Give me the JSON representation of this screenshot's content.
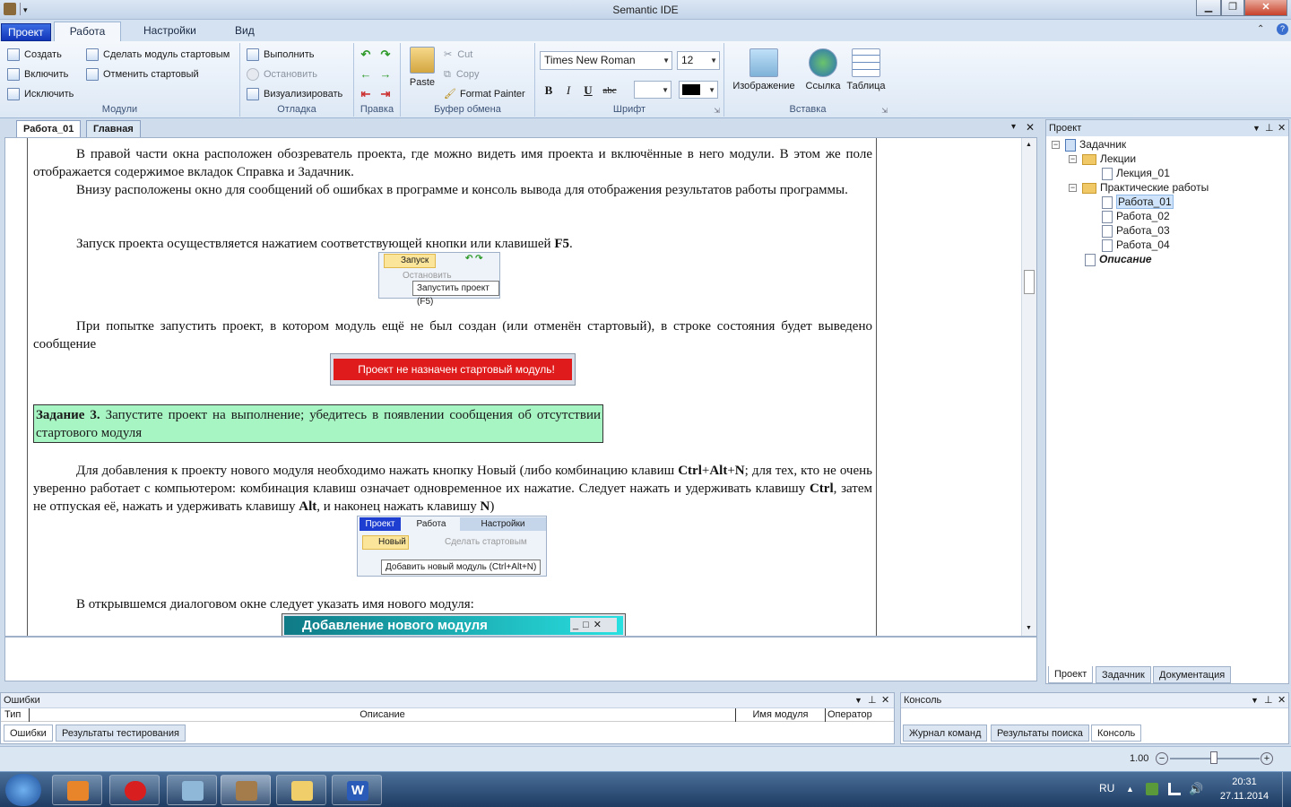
{
  "window": {
    "title": "Semantic IDE"
  },
  "ribbon_tabs": [
    "Проект",
    "Работа",
    "Настройки",
    "Вид"
  ],
  "groups": {
    "modules": {
      "label": "Модули",
      "create": "Создать",
      "include": "Включить",
      "exclude": "Исключить",
      "make_start": "Сделать модуль стартовым",
      "cancel_start": "Отменить стартовый"
    },
    "debug": {
      "label": "Отладка",
      "run": "Выполнить",
      "stop": "Остановить",
      "visualize": "Визуализировать"
    },
    "edit": {
      "label": "Правка"
    },
    "clipboard": {
      "label": "Буфер обмена",
      "paste": "Paste",
      "cut": "Cut",
      "copy": "Copy",
      "format_painter": "Format Painter"
    },
    "font": {
      "label": "Шрифт",
      "family": "Times New Roman",
      "size": "12",
      "bold": "B",
      "italic": "I",
      "underline": "U",
      "strike": "abc"
    },
    "insert": {
      "label": "Вставка",
      "image": "Изображение",
      "link": "Ссылка",
      "table": "Таблица"
    }
  },
  "doc_tabs": [
    "Работа_01",
    "Главная"
  ],
  "document": {
    "p1": "В правой части окна расположен обозреватель проекта, где можно видеть имя проекта и включённые в него модули. В этом же поле отображается содержимое вкладок Справка и Задачник.",
    "p2": "Внизу расположены окно для сообщений об ошибках в программе и консоль вывода для отображения результатов работы программы.",
    "p3_pre": "Запуск проекта осуществляется нажатием соответствующей кнопки или клавишей ",
    "p3_key": "F5",
    "p3_post": ".",
    "img1": {
      "run": "Запуск",
      "stop": "Остановить",
      "tooltip": "Запустить проект (F5)"
    },
    "p4": "При попытке запустить проект, в котором модуль ещё не был создан (или отменён стартовый), в строке состояния будет выведено сообщение",
    "error_bar": "Проект не назначен стартовый модуль!",
    "task_bold": "Задание 3.",
    "task_text": " Запустите проект на выполнение; убедитесь в появлении сообщения об отсутствии стартового модуля",
    "p5_a": "Для добавления к проекту нового модуля необходимо нажать  кнопку Новый (либо комбинацию клавиш ",
    "p5_ctrl": "Ctrl",
    "p5_plus1": "+",
    "p5_alt": "Alt",
    "p5_plus2": "+",
    "p5_n": "N",
    "p5_b": "; для тех, кто не очень уверенно работает с компьютером: комбинация клавиш означает одновременное их нажатие. Следует нажать и удерживать клавишу ",
    "p5_c": ", затем не отпуская её, нажать и удерживать клавишу ",
    "p5_d": ", и наконец нажать клавишу ",
    "p5_e": ")",
    "img2": {
      "tab1": "Проект",
      "tab2": "Работа",
      "tab3": "Настройки",
      "new": "Новый",
      "make_start": "Сделать стартовым",
      "tooltip": "Добавить новый модуль (Ctrl+Alt+N)"
    },
    "p6": "В открывшемся диалоговом окне следует указать имя нового модуля:",
    "dialog_title": "Добавление нового модуля"
  },
  "project_panel": {
    "title": "Проект",
    "root": "Задачник",
    "lectures": "Лекции",
    "lecture1": "Лекция_01",
    "practice": "Практические работы",
    "works": [
      "Работа_01",
      "Работа_02",
      "Работа_03",
      "Работа_04"
    ],
    "description": "Описание",
    "tabs": [
      "Проект",
      "Задачник",
      "Документация"
    ]
  },
  "errors_panel": {
    "title": "Ошибки",
    "columns": [
      "Тип",
      "Описание",
      "Имя модуля",
      "Оператор"
    ],
    "tabs": [
      "Ошибки",
      "Результаты тестирования"
    ]
  },
  "console_panel": {
    "title": "Консоль",
    "tabs": [
      "Журнал команд",
      "Результаты поиска",
      "Консоль"
    ]
  },
  "status": {
    "zoom": "1.00"
  },
  "taskbar": {
    "lang": "RU",
    "time": "20:31",
    "date": "27.11.2014"
  }
}
